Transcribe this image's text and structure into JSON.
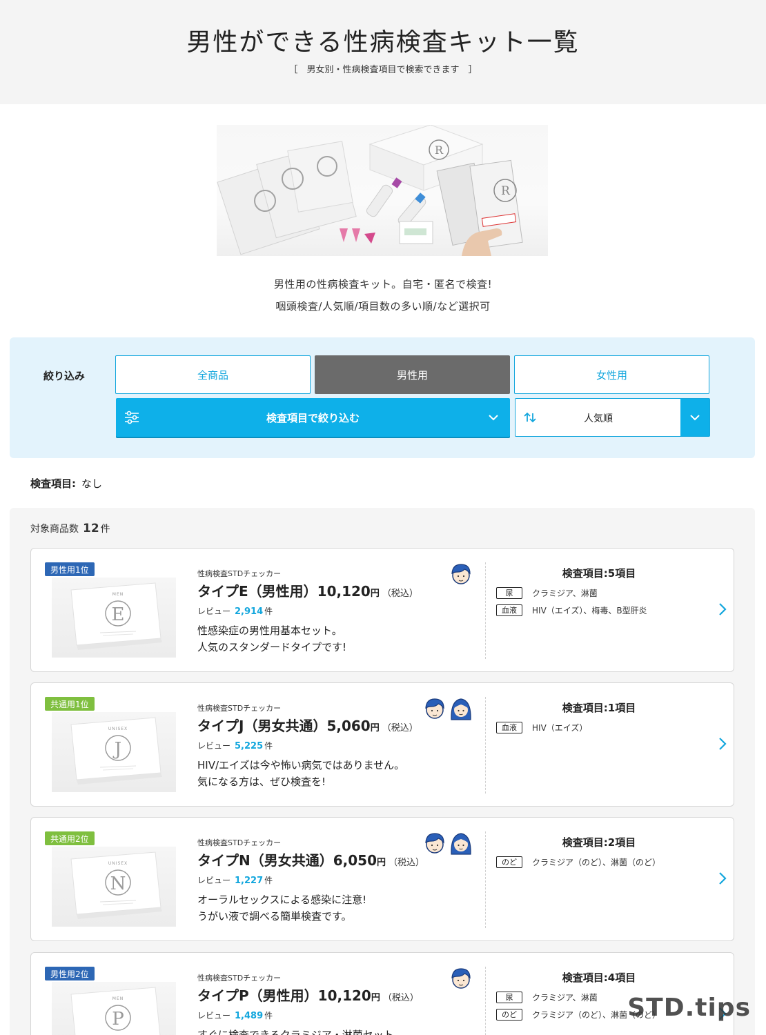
{
  "header": {
    "title": "男性ができる性病検査キット一覧",
    "subtitle": "［　男女別・性病検査項目で検索できます　］"
  },
  "intro": {
    "line1": "男性用の性病検査キット。自宅・匿名で検査!",
    "line2": "咽頭検査/人気順/項目数の多い順/など選択可"
  },
  "filter": {
    "label": "絞り込み",
    "buttons": [
      "全商品",
      "男性用",
      "女性用"
    ],
    "active_index": 1,
    "narrow_label": "検査項目で絞り込む",
    "sort_value": "人気順"
  },
  "inspection": {
    "label": "検査項目:",
    "value": "なし"
  },
  "results": {
    "count_label": "対象商品数",
    "count": "12",
    "count_unit": "件"
  },
  "products": [
    {
      "rank": "男性用1位",
      "rank_type": "men",
      "letter": "E",
      "box_label": "MEN",
      "maker": "性病検査STDチェッカー",
      "name": "タイプE（男性用）",
      "price": "10,120",
      "yen": "円",
      "tax": "（税込）",
      "review_label": "レビュー",
      "review_count": "2,914",
      "review_unit": "件",
      "desc1": "性感染症の男性用基本セット。",
      "desc2": "人気のスタンダードタイプです!",
      "icons": [
        "male-face-icon"
      ],
      "tests_title": "検査項目:5項目",
      "tests": [
        {
          "tag": "尿",
          "items": "クラミジア、淋菌"
        },
        {
          "tag": "血液",
          "items": "HIV（エイズ）、梅毒、B型肝炎"
        }
      ]
    },
    {
      "rank": "共通用1位",
      "rank_type": "uni",
      "letter": "J",
      "box_label": "UNISEX",
      "maker": "性病検査STDチェッカー",
      "name": "タイプJ（男女共通）",
      "price": "5,060",
      "yen": "円",
      "tax": "（税込）",
      "review_label": "レビュー",
      "review_count": "5,225",
      "review_unit": "件",
      "desc1": "HIV/エイズは今や怖い病気ではありません。",
      "desc2": "気になる方は、ぜひ検査を!",
      "icons": [
        "male-face-icon",
        "female-face-icon"
      ],
      "tests_title": "検査項目:1項目",
      "tests": [
        {
          "tag": "血液",
          "items": "HIV（エイズ）"
        }
      ]
    },
    {
      "rank": "共通用2位",
      "rank_type": "uni",
      "letter": "N",
      "box_label": "UNISEX",
      "maker": "性病検査STDチェッカー",
      "name": "タイプN（男女共通）",
      "price": "6,050",
      "yen": "円",
      "tax": "（税込）",
      "review_label": "レビュー",
      "review_count": "1,227",
      "review_unit": "件",
      "desc1": "オーラルセックスによる感染に注意!",
      "desc2": "うがい液で調べる簡単検査です。",
      "icons": [
        "male-face-icon",
        "female-face-icon"
      ],
      "tests_title": "検査項目:2項目",
      "tests": [
        {
          "tag": "のど",
          "items": "クラミジア（のど）、淋菌（のど）"
        }
      ]
    },
    {
      "rank": "男性用2位",
      "rank_type": "men",
      "letter": "P",
      "box_label": "MEN",
      "maker": "性病検査STDチェッカー",
      "name": "タイプP（男性用）",
      "price": "10,120",
      "yen": "円",
      "tax": "（税込）",
      "review_label": "レビュー",
      "review_count": "1,489",
      "review_unit": "件",
      "desc1": "すぐに検査できるクラミジア・淋菌セット",
      "desc2": "",
      "icons": [
        "male-face-icon"
      ],
      "tests_title": "検査項目:4項目",
      "tests": [
        {
          "tag": "尿",
          "items": "クラミジア、淋菌"
        },
        {
          "tag": "のど",
          "items": "クラミジア（のど）、淋菌（のど）"
        }
      ]
    }
  ],
  "watermark": "STD.tips",
  "colors": {
    "accent": "#0eb0e9",
    "men_badge": "#2d67b5",
    "unisex_badge": "#7fbf3f",
    "active_filter": "#6b6b6b"
  }
}
